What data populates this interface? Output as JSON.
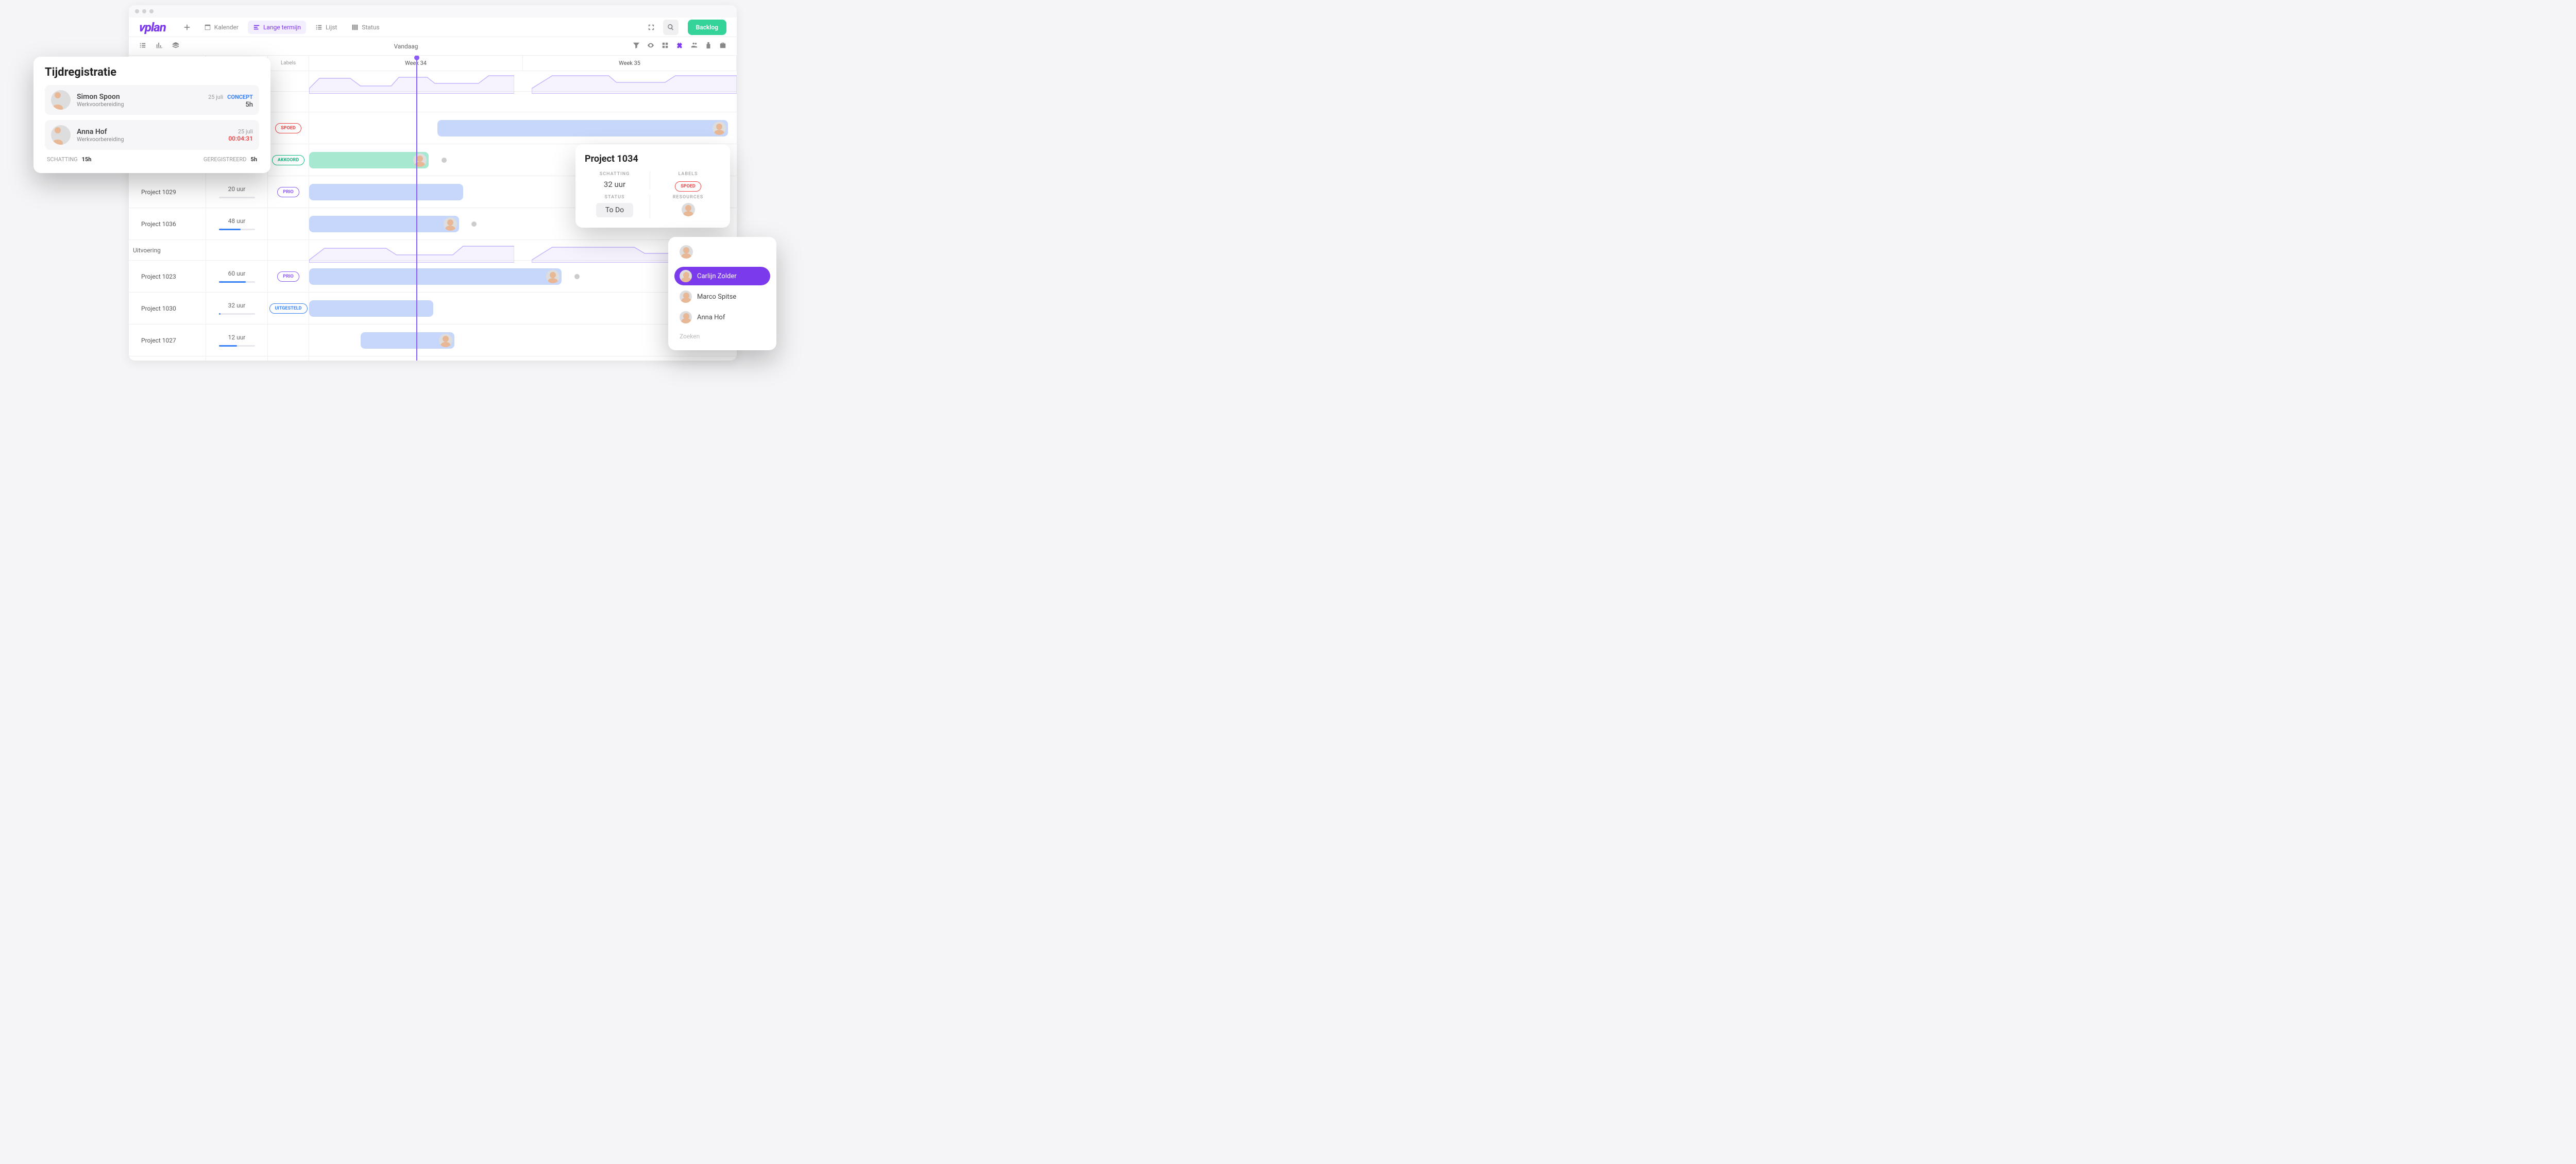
{
  "nav": {
    "kalender": "Kalender",
    "lange_termijn": "Lange termijn",
    "lijst": "Lijst",
    "status": "Status",
    "backlog": "Backlog"
  },
  "toolbar": {
    "vandaag": "Vandaag"
  },
  "headers": {
    "labels": "Labels",
    "week34": "Week 34",
    "week35": "Week 35"
  },
  "groups": {
    "uitvoering": "Uitvoering"
  },
  "projects": [
    {
      "name": "Project 1029",
      "hours": "20 uur",
      "label": "PRIO",
      "labelClass": "pill-purple",
      "progress": 0
    },
    {
      "name": "Project 1036",
      "hours": "48 uur",
      "label": "",
      "labelClass": "",
      "progress": 60
    },
    {
      "name": "Project 1023",
      "hours": "60 uur",
      "label": "PRIO",
      "labelClass": "pill-purple",
      "progress": 75
    },
    {
      "name": "Project 1030",
      "hours": "32 uur",
      "label": "UITGESTELD",
      "labelClass": "pill-blue",
      "progress": 5
    },
    {
      "name": "Project 1027",
      "hours": "12 uur",
      "label": "",
      "labelClass": "",
      "progress": 50
    }
  ],
  "hidden_labels": {
    "spoed": "SPOED",
    "akkoord": "AKKOORD"
  },
  "time_pop": {
    "title": "Tijdregistratie",
    "entries": [
      {
        "name": "Simon Spoon",
        "role": "Werkvoorbereiding",
        "date": "25 juli",
        "status": "CONCEPT",
        "hours": "5h",
        "timer": ""
      },
      {
        "name": "Anna Hof",
        "role": "Werkvoorbereiding",
        "date": "25 juli",
        "status": "",
        "hours": "",
        "timer": "00:04:31"
      }
    ],
    "footer": {
      "schatting_label": "SCHATTING",
      "schatting_val": "15h",
      "gereg_label": "GEREGISTREERD",
      "gereg_val": "5h"
    }
  },
  "proj_pop": {
    "title": "Project 1034",
    "schatting_label": "SCHATTING",
    "schatting_val": "32 uur",
    "labels_label": "LABELS",
    "labels_val": "SPOED",
    "status_label": "STATUS",
    "status_val": "To Do",
    "resources_label": "RESOURCES"
  },
  "res_pop": {
    "items": [
      {
        "name": "Carlijn Zolder",
        "selected": true
      },
      {
        "name": "Marco Spitse",
        "selected": false
      },
      {
        "name": "Anna Hof",
        "selected": false
      }
    ],
    "search": "Zoeken"
  }
}
